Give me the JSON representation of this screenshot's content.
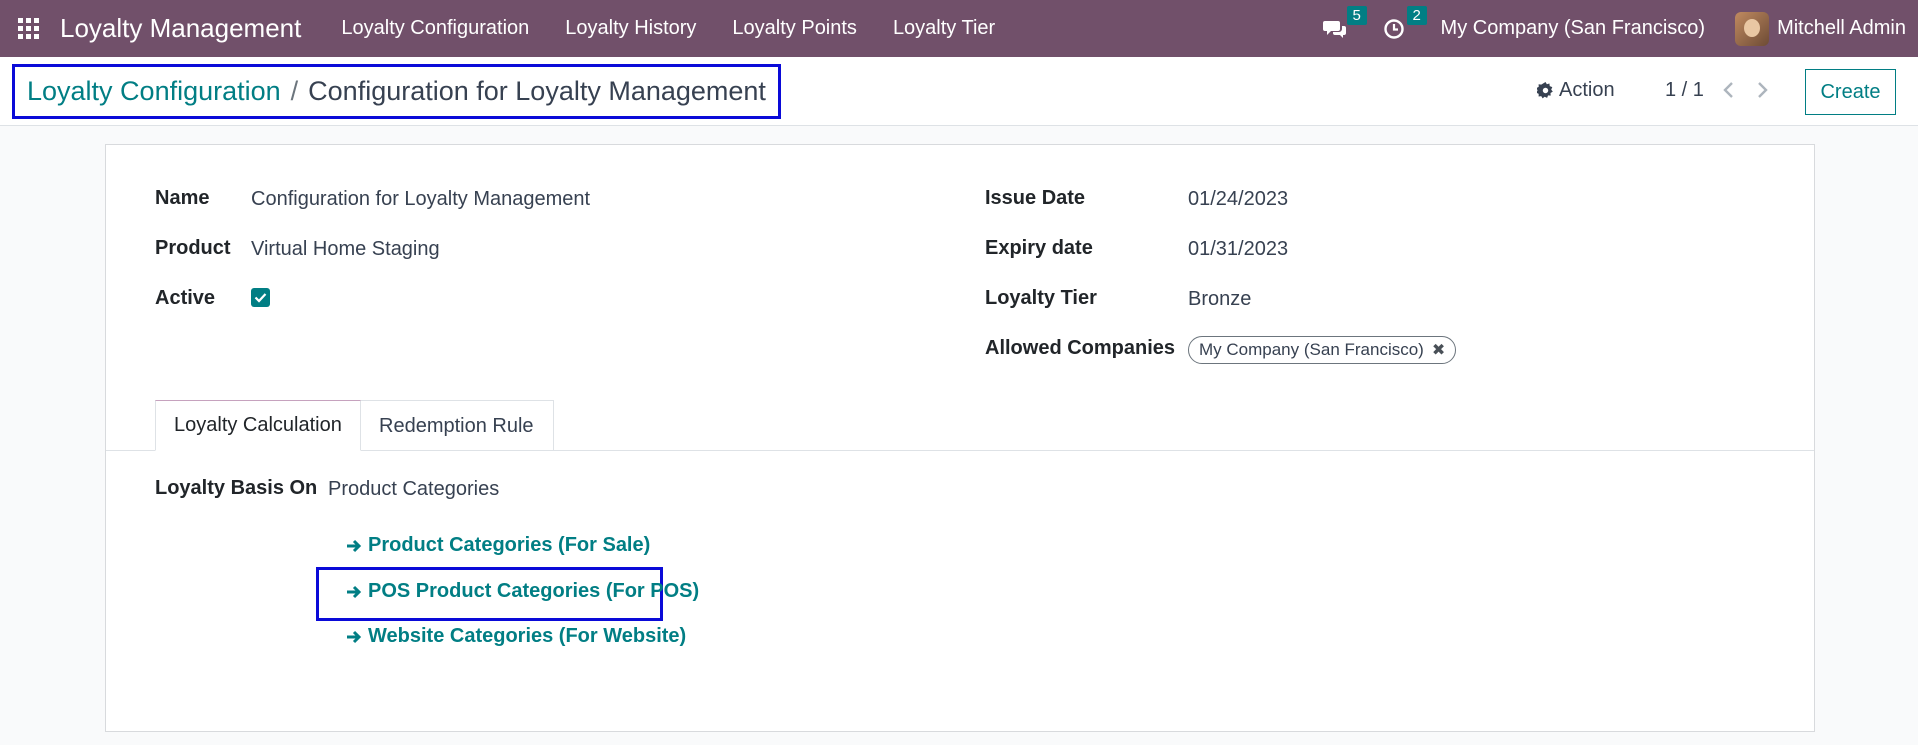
{
  "navbar": {
    "brand": "Loyalty Management",
    "menu": [
      {
        "label": "Loyalty Configuration"
      },
      {
        "label": "Loyalty History"
      },
      {
        "label": "Loyalty Points"
      },
      {
        "label": "Loyalty Tier"
      }
    ],
    "messages_count": "5",
    "activities_count": "2",
    "company": "My Company (San Francisco)",
    "user": "Mitchell Admin"
  },
  "control_panel": {
    "breadcrumb_parent": "Loyalty Configuration",
    "breadcrumb_separator": "/",
    "breadcrumb_current": "Configuration for Loyalty Management",
    "action_label": "Action",
    "pager": "1 / 1",
    "create_label": "Create"
  },
  "form": {
    "name_label": "Name",
    "name_value": "Configuration for Loyalty Management",
    "product_label": "Product",
    "product_value": "Virtual Home Staging",
    "active_label": "Active",
    "active_checked": true,
    "issue_date_label": "Issue Date",
    "issue_date_value": "01/24/2023",
    "expiry_date_label": "Expiry date",
    "expiry_date_value": "01/31/2023",
    "loyalty_tier_label": "Loyalty Tier",
    "loyalty_tier_value": "Bronze",
    "allowed_companies_label": "Allowed Companies",
    "allowed_companies": [
      "My Company (San Francisco)"
    ]
  },
  "tabs": [
    {
      "label": "Loyalty Calculation",
      "active": true
    },
    {
      "label": "Redemption Rule",
      "active": false
    }
  ],
  "loyalty_calculation": {
    "basis_label": "Loyalty Basis On",
    "basis_value": "Product Categories",
    "links": [
      {
        "label": "Product Categories (For Sale)"
      },
      {
        "label": "POS Product Categories (For POS)"
      },
      {
        "label": "Website Categories (For Website)"
      }
    ]
  },
  "colors": {
    "navbar": "#71506a",
    "accent": "#017e84",
    "highlight": "#0a0ad8"
  }
}
